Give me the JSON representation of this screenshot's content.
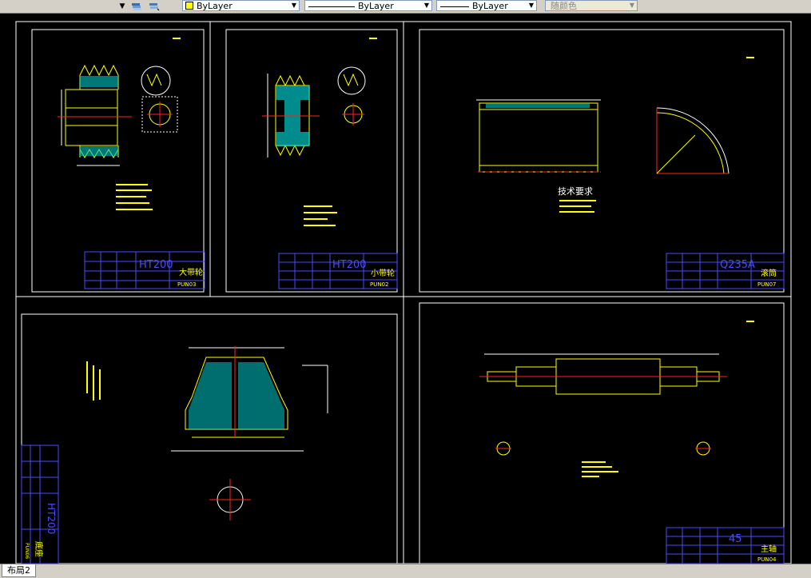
{
  "toolbar": {
    "layer_combo_value": "ByLayer",
    "linetype_combo_value": "ByLayer",
    "lineweight_combo_value": "ByLayer",
    "plotstyle_combo_value": "随颜色",
    "swatch_color": "#ffff00"
  },
  "viewports": {
    "vp1": {
      "material": "HT200",
      "part_name": "大带轮",
      "drawing_no": "PUN03"
    },
    "vp2": {
      "material": "HT200",
      "part_name": "小带轮",
      "drawing_no": "PUN02"
    },
    "vp3": {
      "material": "Q235A",
      "part_name": "滚筒",
      "drawing_no": "PUN07",
      "tech_title": "技术要求"
    },
    "vp4": {
      "material": "HT200",
      "part_name": "底座",
      "drawing_no": "PUN06"
    },
    "vp5": {
      "material": "45",
      "part_name": "主轴",
      "drawing_no": "PUN04"
    }
  },
  "layout_tab": {
    "label": "布局2"
  },
  "colors": {
    "drawing_line": "#ffff00",
    "frame": "#ffffff",
    "title_block": "#4a4aff",
    "hatch": "#00c8c8",
    "center_line": "#ff2020",
    "dim": "#ffffff"
  }
}
